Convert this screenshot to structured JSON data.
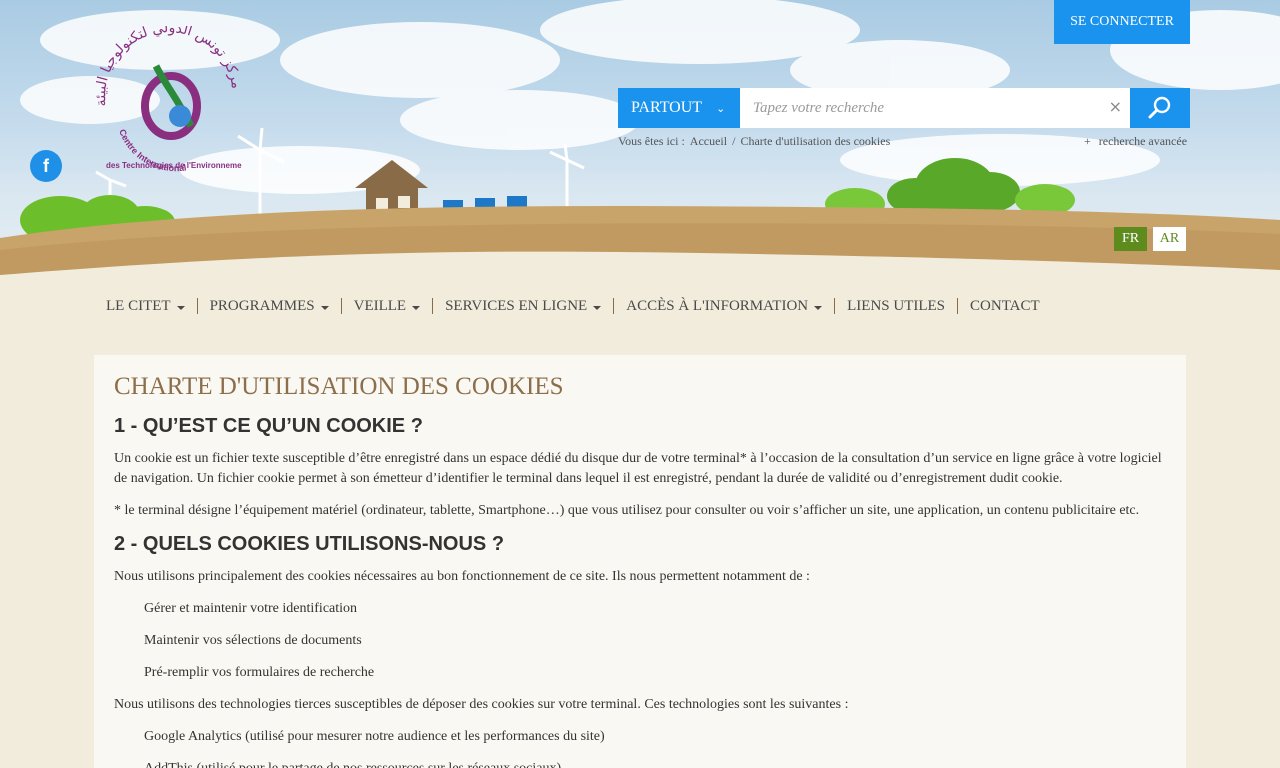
{
  "login": {
    "label": "SE CONNECTER"
  },
  "logo": {
    "arabic_text": "مركز تونس الدولي لتكنولوجيا البيئة",
    "line1": "Centre International",
    "line2": "des Technologies de l'Environnement de Tunis"
  },
  "social": {
    "facebook_glyph": "f"
  },
  "search": {
    "scope_label": "PARTOUT",
    "placeholder": "Tapez votre recherche",
    "clear_glyph": "×",
    "advanced_plus": "+",
    "advanced_label": "recherche avancée"
  },
  "breadcrumb": {
    "prefix": "Vous êtes ici :",
    "home": "Accueil",
    "separator": "/",
    "current": "Charte d'utilisation des cookies"
  },
  "lang": {
    "fr": "FR",
    "ar": "AR"
  },
  "nav": {
    "items": [
      {
        "label": "Le CITET"
      },
      {
        "label": "Programmes"
      },
      {
        "label": "Veille"
      },
      {
        "label": "Services en ligne"
      },
      {
        "label": "Accès à l'information"
      },
      {
        "label": "Liens utiles"
      },
      {
        "label": "Contact"
      }
    ]
  },
  "content": {
    "title": "Charte d'utilisation des cookies",
    "s1_title": "1 - QU’EST CE QU’UN COOKIE ?",
    "s1_p1": "Un cookie est un fichier texte susceptible d’être enregistré dans un espace dédié du disque dur de votre terminal* à l’occasion de la consultation d’un service en ligne grâce à votre logiciel de navigation. Un fichier cookie permet à son émetteur d’identifier le terminal dans lequel il est enregistré, pendant la durée de validité ou d’enregistrement dudit cookie.",
    "s1_p2": "* le terminal désigne l’équipement matériel (ordinateur, tablette, Smartphone…) que vous utilisez pour consulter ou voir s’afficher un site, une application, un contenu publicitaire etc.",
    "s2_title": "2 - QUELS COOKIES UTILISONS-NOUS ?",
    "s2_p1": "Nous utilisons principalement des cookies nécessaires au bon fonctionnement de ce site. Ils nous permettent notamment de :",
    "s2_list": [
      "Gérer et maintenir votre identification",
      "Maintenir vos sélections de documents",
      "Pré-remplir vos formulaires de recherche"
    ],
    "s2_p2": "Nous utilisons des technologies tierces susceptibles de déposer des cookies sur votre terminal. Ces technologies sont les suivantes :",
    "s2_list2": [
      "Google Analytics (utilisé pour mesurer notre audience et les performances du site)",
      "AddThis (utilisé pour le partage de nos ressources sur les réseaux sociaux)"
    ]
  },
  "colors": {
    "accent_blue": "#1a93ee",
    "title_brown": "#8d6e4b",
    "lang_green": "#5e8b1e",
    "page_bg": "#f1ecdc"
  }
}
